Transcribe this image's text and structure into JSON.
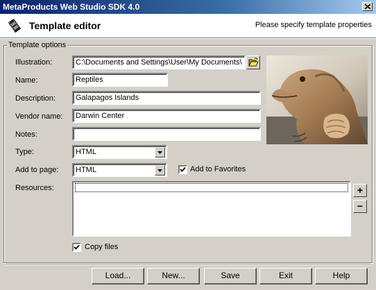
{
  "window": {
    "title": "MetaProducts Web Studio SDK 4.0"
  },
  "header": {
    "title": "Template editor",
    "subtitle": "Please specify template properties"
  },
  "group": {
    "title": "Template options"
  },
  "labels": {
    "illustration": "Illustration:",
    "name": "Name:",
    "description": "Description:",
    "vendor_name": "Vendor name:",
    "notes": "Notes:",
    "type": "Type:",
    "add_to_page": "Add to page:",
    "resources": "Resources:"
  },
  "fields": {
    "illustration": "C:\\Documents and Settings\\User\\My Documents\\",
    "name": "Reptiles",
    "description": "Galapagos Islands",
    "vendor_name": "Darwin Center",
    "notes": "",
    "type": "HTML",
    "add_to_page": "HTML"
  },
  "checkboxes": {
    "add_to_favorites": {
      "label": "Add to Favorites",
      "checked": true
    },
    "copy_files": {
      "label": "Copy files",
      "checked": true
    }
  },
  "resource_buttons": {
    "add": "+",
    "remove": "−"
  },
  "buttons": {
    "load": "Load...",
    "new": "New...",
    "save": "Save",
    "exit": "Exit",
    "help": "Help"
  },
  "icons": [
    "close-icon",
    "film-icon",
    "folder-open-icon",
    "dropdown-arrow-icon",
    "checkmark-icon"
  ]
}
